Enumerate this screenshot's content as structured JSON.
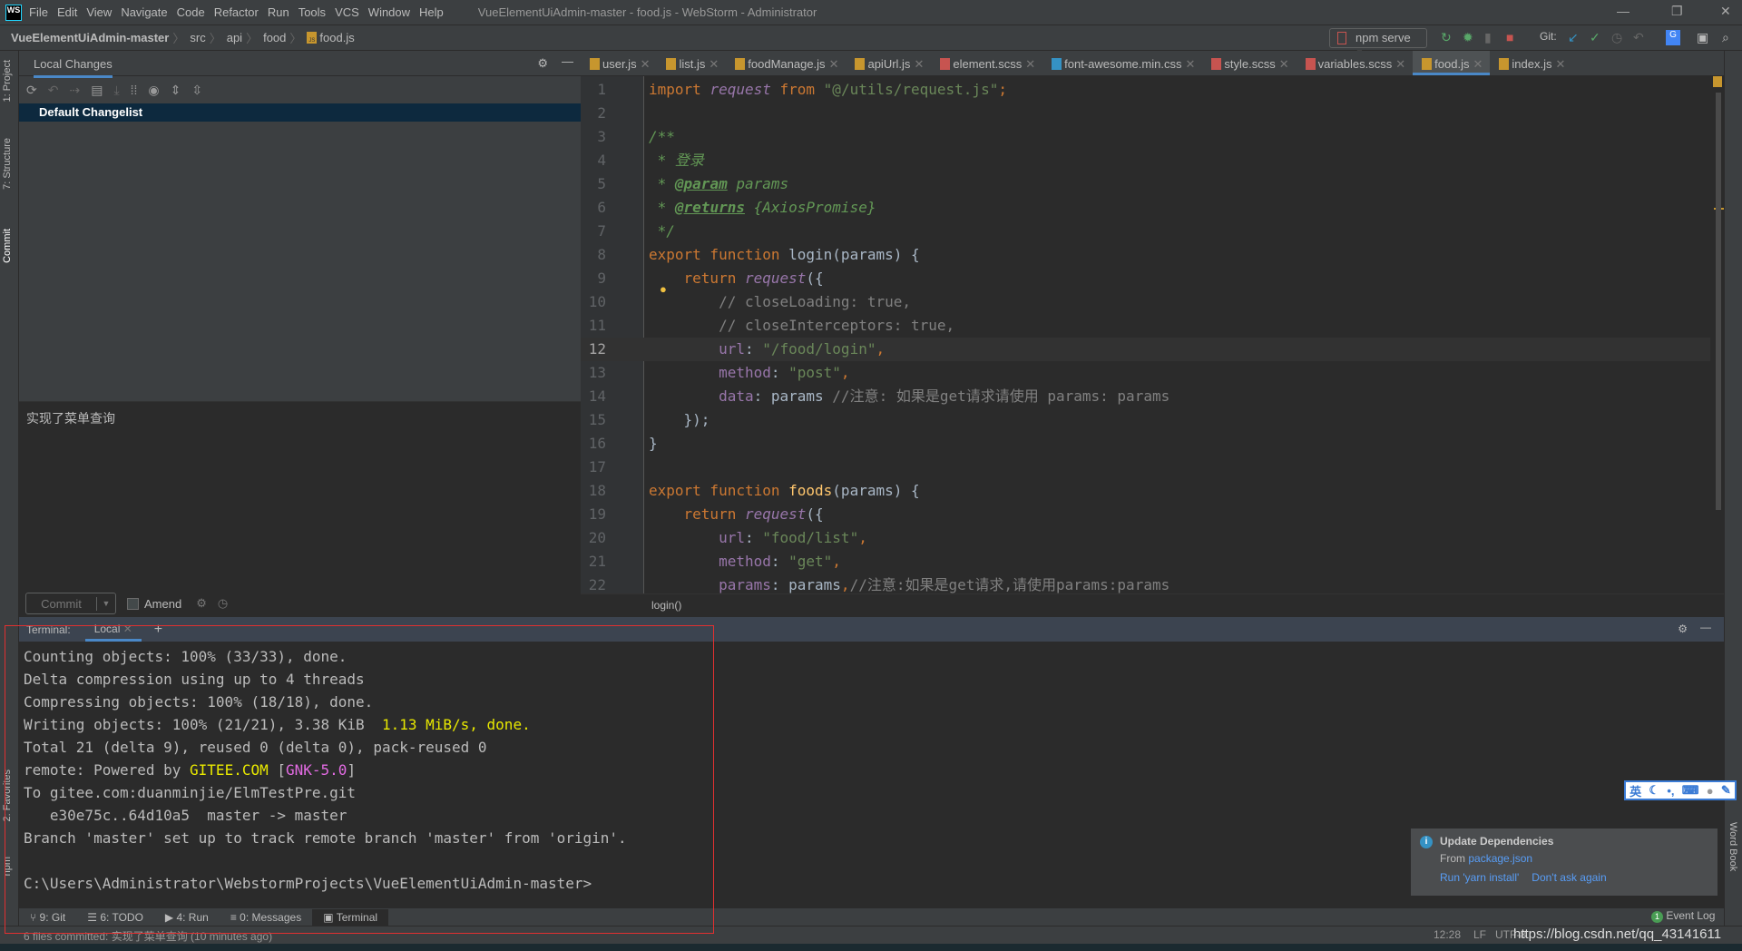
{
  "app": {
    "logo": "WS",
    "title": "VueElementUiAdmin-master - food.js - WebStorm - Administrator"
  },
  "menu": [
    "File",
    "Edit",
    "View",
    "Navigate",
    "Code",
    "Refactor",
    "Run",
    "Tools",
    "VCS",
    "Window",
    "Help"
  ],
  "breadcrumb": [
    "VueElementUiAdmin-master",
    "src",
    "api",
    "food",
    "food.js"
  ],
  "toolbar": {
    "run_config": "npm serve",
    "git_label": "Git:"
  },
  "left_stripe": [
    "1: Project",
    "7: Structure",
    "Commit",
    "2: Favorites",
    "npm"
  ],
  "right_stripe": [
    "Word Book"
  ],
  "commit_panel": {
    "tab": "Local Changes",
    "changelist": "Default Changelist",
    "message": "实现了菜单查询",
    "commit_label": "Commit",
    "amend_label": "Amend",
    "amend_checked": false
  },
  "editor": {
    "tabs": [
      {
        "name": "user.js",
        "type": "js"
      },
      {
        "name": "list.js",
        "type": "js"
      },
      {
        "name": "foodManage.js",
        "type": "js"
      },
      {
        "name": "apiUrl.js",
        "type": "js"
      },
      {
        "name": "element.scss",
        "type": "sass"
      },
      {
        "name": "font-awesome.min.css",
        "type": "css"
      },
      {
        "name": "style.scss",
        "type": "sass"
      },
      {
        "name": "variables.scss",
        "type": "sass"
      },
      {
        "name": "food.js",
        "type": "js",
        "active": true
      },
      {
        "name": "index.js",
        "type": "js"
      }
    ],
    "current_line": 12,
    "lines": [
      [
        [
          "kw",
          "import "
        ],
        [
          "it",
          "request"
        ],
        [
          "kw",
          " from "
        ],
        [
          "str",
          "\"@/utils/request.js\""
        ],
        [
          "kw",
          ";"
        ]
      ],
      [],
      [
        [
          "dc",
          "/**"
        ]
      ],
      [
        [
          "dc",
          " * 登录"
        ]
      ],
      [
        [
          "dc",
          " * "
        ],
        [
          "dt",
          "@param"
        ],
        [
          "dc",
          " params"
        ]
      ],
      [
        [
          "dc",
          " * "
        ],
        [
          "dt",
          "@returns"
        ],
        [
          "dc",
          " {AxiosPromise}"
        ]
      ],
      [
        [
          "dc",
          " */"
        ]
      ],
      [
        [
          "kw",
          "export function "
        ],
        [
          "fnn",
          "login"
        ],
        [
          "pl",
          "(params) {"
        ]
      ],
      [
        [
          "kw",
          "    return "
        ],
        [
          "it",
          "request"
        ],
        [
          "pl",
          "({"
        ]
      ],
      [
        [
          "cm",
          "        // closeLoading: true,"
        ]
      ],
      [
        [
          "cm",
          "        // closeInterceptors: true,"
        ]
      ],
      [
        [
          "pr",
          "        url"
        ],
        [
          "pl",
          ": "
        ],
        [
          "str",
          "\"/food/login\""
        ],
        [
          "kw",
          ","
        ]
      ],
      [
        [
          "pr",
          "        method"
        ],
        [
          "pl",
          ": "
        ],
        [
          "str",
          "\"post\""
        ],
        [
          "kw",
          ","
        ]
      ],
      [
        [
          "pr",
          "        data"
        ],
        [
          "pl",
          ": params "
        ],
        [
          "cm",
          "//注意: 如果是get请求请使用 params: params"
        ]
      ],
      [
        [
          "pl",
          "    });"
        ]
      ],
      [
        [
          "pl",
          "}"
        ]
      ],
      [],
      [
        [
          "kw",
          "export function "
        ],
        [
          "fn",
          "foods"
        ],
        [
          "pl",
          "(params) {"
        ]
      ],
      [
        [
          "kw",
          "    return "
        ],
        [
          "it",
          "request"
        ],
        [
          "pl",
          "({"
        ]
      ],
      [
        [
          "pr",
          "        url"
        ],
        [
          "pl",
          ": "
        ],
        [
          "str",
          "\"food/list\""
        ],
        [
          "kw",
          ","
        ]
      ],
      [
        [
          "pr",
          "        method"
        ],
        [
          "pl",
          ": "
        ],
        [
          "str",
          "\"get\""
        ],
        [
          "kw",
          ","
        ]
      ],
      [
        [
          "pr",
          "        params"
        ],
        [
          "pl",
          ": params"
        ],
        [
          "kw",
          ","
        ],
        [
          "cm",
          "//注意:如果是get请求,请使用params:params"
        ]
      ]
    ],
    "breadcrumb": "login()"
  },
  "terminal": {
    "label": "Terminal:",
    "tab": "Local",
    "lines": [
      "Counting objects: 100% (33/33), done.",
      "Delta compression using up to 4 threads",
      "Compressing objects: 100% (18/18), done.",
      "Writing objects: 100% (21/21), 3.38 KiB | 1.13 MiB/s, done.",
      "Total 21 (delta 9), reused 0 (delta 0), pack-reused 0",
      "remote: Powered by |GITEE.COM| [|GNK-5.0|]",
      "To gitee.com:duanminjie/ElmTestPre.git",
      "   e30e75c..64d10a5  master -> master",
      "Branch 'master' set up to track remote branch 'master' from 'origin'.",
      "",
      "C:\\Users\\Administrator\\WebstormProjects\\VueElementUiAdmin-master>"
    ]
  },
  "bottom_tabs": [
    "9: Git",
    "6: TODO",
    "4: Run",
    "0: Messages",
    "Terminal"
  ],
  "status": {
    "message": "6 files committed: 实现了菜单查询 (10 minutes ago)",
    "position": "12:28",
    "line_sep": "LF",
    "encoding": "UTF-8",
    "watermark": "https://blog.csdn.net/qq_43141611"
  },
  "event_log": {
    "label": "Event Log",
    "count": "1"
  },
  "notification": {
    "title": "Update Dependencies",
    "from": "From",
    "link": "package.json",
    "actions": [
      "Run 'yarn install'",
      "Don't ask again"
    ]
  },
  "ime": {
    "mode": "英"
  }
}
